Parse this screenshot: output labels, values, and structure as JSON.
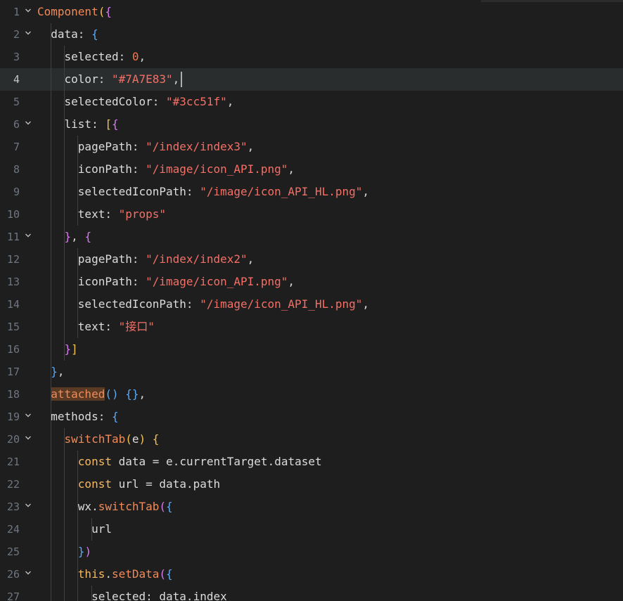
{
  "editor": {
    "active_line": 4,
    "lines": [
      {
        "n": "1",
        "t": "Component({"
      },
      {
        "n": "2",
        "t": "  data: {"
      },
      {
        "n": "3",
        "t": "    selected: 0,"
      },
      {
        "n": "4",
        "t": "    color: \"#7A7E83\","
      },
      {
        "n": "5",
        "t": "    selectedColor: \"#3cc51f\","
      },
      {
        "n": "6",
        "t": "    list: [{"
      },
      {
        "n": "7",
        "t": "      pagePath: \"/index/index3\","
      },
      {
        "n": "8",
        "t": "      iconPath: \"/image/icon_API.png\","
      },
      {
        "n": "9",
        "t": "      selectedIconPath: \"/image/icon_API_HL.png\","
      },
      {
        "n": "10",
        "t": "      text: \"props\""
      },
      {
        "n": "11",
        "t": "    }, {"
      },
      {
        "n": "12",
        "t": "      pagePath: \"/index/index2\","
      },
      {
        "n": "13",
        "t": "      iconPath: \"/image/icon_API.png\","
      },
      {
        "n": "14",
        "t": "      selectedIconPath: \"/image/icon_API_HL.png\","
      },
      {
        "n": "15",
        "t": "      text: \"接口\""
      },
      {
        "n": "16",
        "t": "    }]"
      },
      {
        "n": "17",
        "t": "  },"
      },
      {
        "n": "18",
        "t": "  attached() {},"
      },
      {
        "n": "19",
        "t": "  methods: {"
      },
      {
        "n": "20",
        "t": "    switchTab(e) {"
      },
      {
        "n": "21",
        "t": "      const data = e.currentTarget.dataset"
      },
      {
        "n": "22",
        "t": "      const url = data.path"
      },
      {
        "n": "23",
        "t": "      wx.switchTab({"
      },
      {
        "n": "24",
        "t": "        url"
      },
      {
        "n": "25",
        "t": "      })"
      },
      {
        "n": "26",
        "t": "      this.setData({"
      },
      {
        "n": "27",
        "t": "        selected: data.index"
      }
    ],
    "fold_lines": [
      "1",
      "2",
      "6",
      "11",
      "19",
      "20",
      "23",
      "26"
    ],
    "colors": {
      "background": "#1e1e1e",
      "string": "#f47067",
      "number": "#f3774e",
      "function": "#f0a35e",
      "bracket_1": "#f6c44d",
      "bracket_2": "#d97af0",
      "bracket_3": "#5da9f5"
    },
    "icons": {
      "fold": "chevron-down-icon"
    }
  }
}
